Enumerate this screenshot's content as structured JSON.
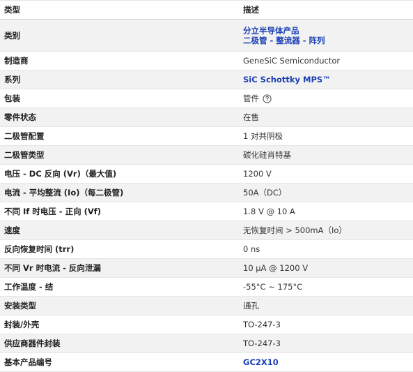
{
  "header": {
    "col1": "类型",
    "col2": "描述"
  },
  "rows": [
    {
      "label": "类别",
      "values": [
        "分立半导体产品",
        "二极管 - 整流器 - 阵列"
      ]
    },
    {
      "label": "制造商",
      "value": "GeneSiC Semiconductor"
    },
    {
      "label": "系列",
      "value": "SiC Schottky MPS™"
    },
    {
      "label": "包装",
      "value": "管件"
    },
    {
      "label": "零件状态",
      "value": "在售"
    },
    {
      "label": "二极管配置",
      "value": "1 对共阴极"
    },
    {
      "label": "二极管类型",
      "value": "碳化硅肖特基"
    },
    {
      "label": "电压 - DC 反向 (Vr)（最大值)",
      "value": "1200 V"
    },
    {
      "label": "电流 - 平均整流 (Io)（每二极管)",
      "value": "50A（DC）"
    },
    {
      "label": "不同 If 时电压 - 正向 (Vf)",
      "value": "1.8 V @ 10 A"
    },
    {
      "label": "速度",
      "value": "无恢复时间 > 500mA（Io）"
    },
    {
      "label": "反向恢复时间 (trr)",
      "value": "0 ns"
    },
    {
      "label": "不同 Vr 时电流 - 反向泄漏",
      "value": "10 µA @ 1200 V"
    },
    {
      "label": "工作温度 - 结",
      "value": "-55°C ~ 175°C"
    },
    {
      "label": "安装类型",
      "value": "通孔"
    },
    {
      "label": "封装/外壳",
      "value": "TO-247-3"
    },
    {
      "label": "供应商器件封装",
      "value": "TO-247-3"
    },
    {
      "label": "基本产品编号",
      "value": "GC2X10"
    }
  ],
  "icons": {
    "help": "help-circle-icon"
  },
  "colors": {
    "link": "#1a3fb5",
    "alt_row": "#f2f2f2",
    "border": "#e6e6e6"
  }
}
